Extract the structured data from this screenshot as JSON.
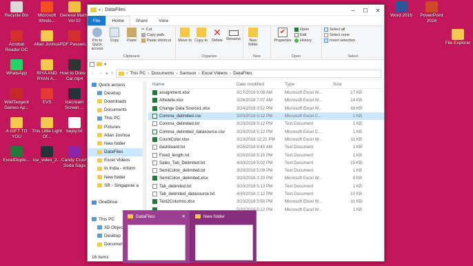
{
  "desktop": {
    "icons_left": [
      {
        "label": "Recycle Bin",
        "color": "#d9d9d9"
      },
      {
        "label": "Microsoft Windo...",
        "color": "#f25022"
      },
      {
        "label": "General Maths Vol 02",
        "color": "#f0c040"
      },
      {
        "label": "Acrobat Reader DC",
        "color": "#d32f2f"
      },
      {
        "label": "Allan Joshua",
        "color": "#f2c94c"
      },
      {
        "label": "PDF Passwo...",
        "color": "#d32f2f"
      },
      {
        "label": "WhatsApp",
        "color": "#25d366"
      },
      {
        "label": "RIYA AND RYAN A...",
        "color": "#f2c94c"
      },
      {
        "label": "How to Drew a Car.mp4",
        "color": "#333333"
      },
      {
        "label": "WildTangent Games Ap...",
        "color": "#c62828"
      },
      {
        "label": "EVS",
        "color": "#e53935"
      },
      {
        "label": "Icecream Screen ...",
        "color": "#263238"
      },
      {
        "label": "A GIFT TO YOU",
        "color": "#f2c94c"
      },
      {
        "label": "This Little Light Of...",
        "color": "#f2c94c"
      },
      {
        "label": "bejoy.txt",
        "color": "#ffffff"
      },
      {
        "label": "ExcelDuplic...",
        "color": "#1f7a3c"
      },
      {
        "label": "ice_video_2...",
        "color": "#263238"
      },
      {
        "label": "Candy Crush Soda Saga",
        "color": "#8e24aa"
      }
    ],
    "icons_right": [
      {
        "label": "Word 2016",
        "color": "#2b579a"
      },
      {
        "label": "PowerPoint 2016",
        "color": "#d24726"
      },
      {
        "label": "File Explorer",
        "color": "#f2c94c"
      }
    ]
  },
  "window": {
    "title": "DataFiles",
    "tabs": [
      "File",
      "Home",
      "Share",
      "View"
    ],
    "ribbon": {
      "clipboard": {
        "label": "Clipboard",
        "pin": "Pin to Quick access",
        "copy": "Copy",
        "paste": "Paste",
        "cut": "Cut",
        "copy_path": "Copy path",
        "paste_shortcut": "Paste shortcut"
      },
      "organize": {
        "label": "Organize",
        "move_to": "Move to",
        "copy_to": "Copy to",
        "delete": "Delete",
        "rename": "Rename"
      },
      "new": {
        "label": "New",
        "new_folder": "New folder"
      },
      "open": {
        "label": "Open",
        "properties": "Properties",
        "open": "Open",
        "edit": "Edit",
        "history": "History"
      },
      "select": {
        "label": "Select",
        "select_all": "Select all",
        "select_none": "Select none",
        "invert": "Invert selection"
      }
    },
    "breadcrumb": [
      "This PC",
      "Documents",
      "Samson",
      "Excel Videos",
      "DataFiles"
    ],
    "nav": [
      {
        "label": "Quick access",
        "sub": false,
        "sel": false
      },
      {
        "label": "Desktop",
        "sub": true,
        "sel": false
      },
      {
        "label": "Downloads",
        "sub": true,
        "sel": false
      },
      {
        "label": "Documents",
        "sub": true,
        "sel": false
      },
      {
        "label": "This PC",
        "sub": true,
        "sel": false
      },
      {
        "label": "Pictures",
        "sub": true,
        "sel": false
      },
      {
        "label": "Allan Joshua",
        "sub": true,
        "sel": false
      },
      {
        "label": "New folder",
        "sub": true,
        "sel": false
      },
      {
        "label": "DataFiles",
        "sub": true,
        "sel": true
      },
      {
        "label": "Excel Videos",
        "sub": true,
        "sel": false
      },
      {
        "label": "In India - Inform",
        "sub": true,
        "sel": false
      },
      {
        "label": "New folder",
        "sub": true,
        "sel": false
      },
      {
        "label": "SR - Singapore a",
        "sub": true,
        "sel": false
      },
      {
        "label": "",
        "sub": false,
        "sel": false
      },
      {
        "label": "OneDrive",
        "sub": false,
        "sel": false
      },
      {
        "label": "",
        "sub": false,
        "sel": false
      },
      {
        "label": "This PC",
        "sub": false,
        "sel": false
      },
      {
        "label": "3D Objects",
        "sub": true,
        "sel": false
      },
      {
        "label": "Desktop",
        "sub": true,
        "sel": false
      },
      {
        "label": "Documents",
        "sub": true,
        "sel": false
      }
    ],
    "columns": {
      "name": "Name",
      "date": "Date modified",
      "type": "Type",
      "size": "Size"
    },
    "files": [
      {
        "name": "assignment.xlsx",
        "date": "3/27/2018 8:08 AM",
        "type": "Microsoft Excel W...",
        "size": "17 KB",
        "kind": "xl"
      },
      {
        "name": "Athelete.xlsx",
        "date": "3/26/2018 7:07 AM",
        "type": "Microsoft Excel W...",
        "size": "14 KB",
        "kind": "xl"
      },
      {
        "name": "Change Data Source1.xlsx",
        "date": "3/24/2018 3:52 PM",
        "type": "Microsoft Excel W...",
        "size": "38 KB",
        "kind": "xl"
      },
      {
        "name": "Comma_delimited.csv",
        "date": "3/20/2018 5:12 PM",
        "type": "Microsoft Excel C...",
        "size": "1 KB",
        "kind": "csv",
        "sel": true
      },
      {
        "name": "Comma_delimited.txt",
        "date": "3/20/2018 5:12 PM",
        "type": "Text Document",
        "size": "1 KB",
        "kind": "tx"
      },
      {
        "name": "Comma_delimited_datasource.csv",
        "date": "3/20/2018 5:12 PM",
        "type": "Microsoft Excel C...",
        "size": "1 KB",
        "kind": "csv"
      },
      {
        "name": "CountColor.xlsx",
        "date": "3/23/2018 12:21 PM",
        "type": "Microsoft Excel W...",
        "size": "11 KB",
        "kind": "xl"
      },
      {
        "name": "dashboard.txt",
        "date": "3/25/2018 6:43 AM",
        "type": "Text Document",
        "size": "1 KB",
        "kind": "tx"
      },
      {
        "name": "Fixed_length.txt",
        "date": "3/20/2018 5:15 PM",
        "type": "Text Document",
        "size": "1 KB",
        "kind": "tx"
      },
      {
        "name": "Sales_Tab_Delimited.txt",
        "date": "4/30/2018 5:02 PM",
        "type": "Text Document",
        "size": "15 KB",
        "kind": "tx"
      },
      {
        "name": "SemiColon_delimited.txt",
        "date": "3/20/2018 5:09 PM",
        "type": "Text Document",
        "size": "1 KB",
        "kind": "tx"
      },
      {
        "name": "SemiColon_delimited.xlsx",
        "date": "3/20/2018 2:20 PM",
        "type": "Microsoft Excel W...",
        "size": "8 KB",
        "kind": "xl"
      },
      {
        "name": "Tab_delimited.txt",
        "date": "3/20/2018 5:13 PM",
        "type": "Text Document",
        "size": "1 KB",
        "kind": "tx"
      },
      {
        "name": "Tab_delimited_datasource.txt",
        "date": "4/30/2018 2:12 PM",
        "type": "Text Document",
        "size": "10 KB",
        "kind": "tx"
      },
      {
        "name": "Text2Columns.xlsx",
        "date": "3/20/2018 5:50 PM",
        "type": "Microsoft Excel W...",
        "size": "11 KB",
        "kind": "xl"
      },
      {
        "name": "",
        "date": "5/20/2018 5:12 PM",
        "type": "Microsoft Excel W...",
        "size": "1 KB",
        "kind": "xl"
      }
    ],
    "status": "16 items"
  },
  "taskbar_preview": {
    "items": [
      {
        "title": "DataFiles",
        "close": "✕"
      },
      {
        "title": "New folder"
      }
    ]
  }
}
